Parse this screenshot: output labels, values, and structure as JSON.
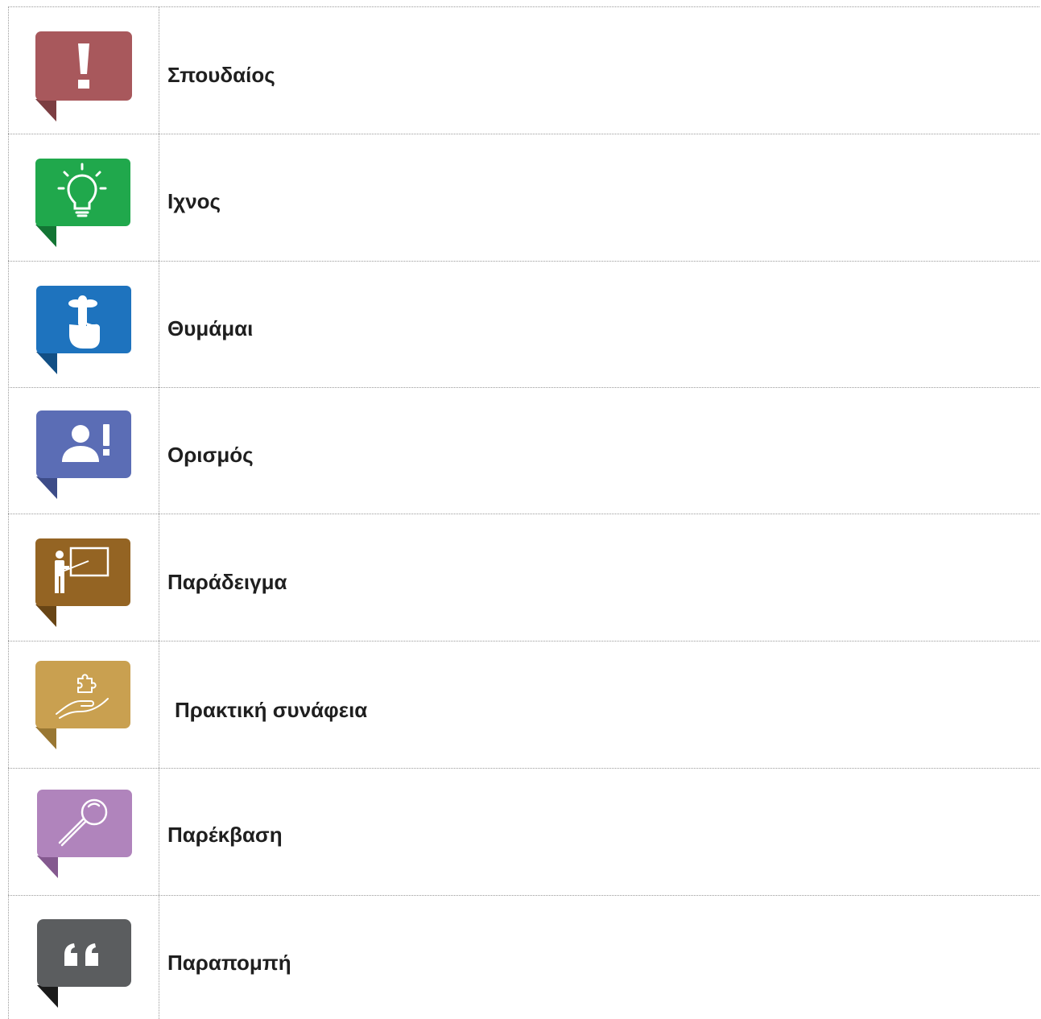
{
  "rows": [
    {
      "label": "Σπουδαίος",
      "icon": "exclamation-icon",
      "color": "#a8585c",
      "tail": "#7c3e42"
    },
    {
      "label": "Ιχνος",
      "icon": "lightbulb-icon",
      "color": "#20a84c",
      "tail": "#137534"
    },
    {
      "label": "Θυμάμαι",
      "icon": "finger-string-icon",
      "color": "#1e73be",
      "tail": "#124f85"
    },
    {
      "label": "Ορισμός",
      "icon": "person-exclamation-icon",
      "color": "#5b6db5",
      "tail": "#3d4c88"
    },
    {
      "label": "Παράδειγμα",
      "icon": "teacher-board-icon",
      "color": "#946423",
      "tail": "#684515"
    },
    {
      "label": "Πρακτική συνάφεια",
      "icon": "hand-puzzle-icon",
      "color": "#c9a050",
      "tail": "#997733"
    },
    {
      "label": "Παρέκβαση",
      "icon": "magnifier-icon",
      "color": "#b084bc",
      "tail": "#84598f"
    },
    {
      "label": "Παραπομπή",
      "icon": "quote-icon",
      "color": "#5b5d5f",
      "tail": "#1a1a1a"
    }
  ]
}
